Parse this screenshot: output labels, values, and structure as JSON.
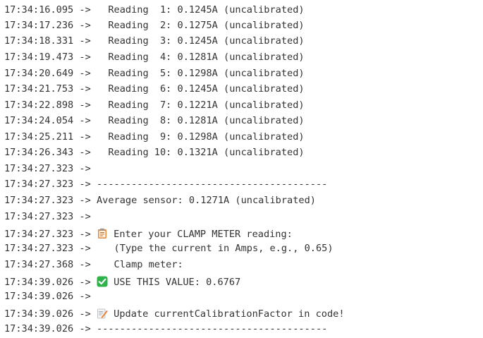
{
  "console": {
    "lines": [
      {
        "time": "17:34:16.095",
        "arrow": "->",
        "text": "  Reading  1: 0.1245A (uncalibrated)"
      },
      {
        "time": "17:34:17.236",
        "arrow": "->",
        "text": "  Reading  2: 0.1275A (uncalibrated)"
      },
      {
        "time": "17:34:18.331",
        "arrow": "->",
        "text": "  Reading  3: 0.1245A (uncalibrated)"
      },
      {
        "time": "17:34:19.473",
        "arrow": "->",
        "text": "  Reading  4: 0.1281A (uncalibrated)"
      },
      {
        "time": "17:34:20.649",
        "arrow": "->",
        "text": "  Reading  5: 0.1298A (uncalibrated)"
      },
      {
        "time": "17:34:21.753",
        "arrow": "->",
        "text": "  Reading  6: 0.1245A (uncalibrated)"
      },
      {
        "time": "17:34:22.898",
        "arrow": "->",
        "text": "  Reading  7: 0.1221A (uncalibrated)"
      },
      {
        "time": "17:34:24.054",
        "arrow": "->",
        "text": "  Reading  8: 0.1281A (uncalibrated)"
      },
      {
        "time": "17:34:25.211",
        "arrow": "->",
        "text": "  Reading  9: 0.1298A (uncalibrated)"
      },
      {
        "time": "17:34:26.343",
        "arrow": "->",
        "text": "  Reading 10: 0.1321A (uncalibrated)"
      },
      {
        "time": "17:34:27.323",
        "arrow": "->",
        "text": ""
      },
      {
        "time": "17:34:27.323",
        "arrow": "->",
        "text": "----------------------------------------"
      },
      {
        "time": "17:34:27.323",
        "arrow": "->",
        "text": "Average sensor: 0.1271A (uncalibrated)"
      },
      {
        "time": "17:34:27.323",
        "arrow": "->",
        "text": ""
      },
      {
        "time": "17:34:27.323",
        "arrow": "->",
        "icon": "clipboard-icon",
        "text": "Enter your CLAMP METER reading:"
      },
      {
        "time": "17:34:27.323",
        "arrow": "->",
        "text": "   (Type the current in Amps, e.g., 0.65)"
      },
      {
        "time": "17:34:27.368",
        "arrow": "->",
        "text": "   Clamp meter:"
      },
      {
        "time": "17:34:39.026",
        "arrow": "->",
        "icon": "check-mark-icon",
        "text": "USE THIS VALUE: 0.6767"
      },
      {
        "time": "17:34:39.026",
        "arrow": "->",
        "text": ""
      },
      {
        "time": "17:34:39.026",
        "arrow": "->",
        "icon": "memo-icon",
        "text": "Update currentCalibrationFactor in code!"
      },
      {
        "time": "17:34:39.026",
        "arrow": "->",
        "text": "----------------------------------------"
      }
    ]
  },
  "colors": {
    "text": "#333333",
    "background": "#ffffff",
    "check_green": "#2db34a",
    "clipboard_orange": "#e8873a"
  }
}
